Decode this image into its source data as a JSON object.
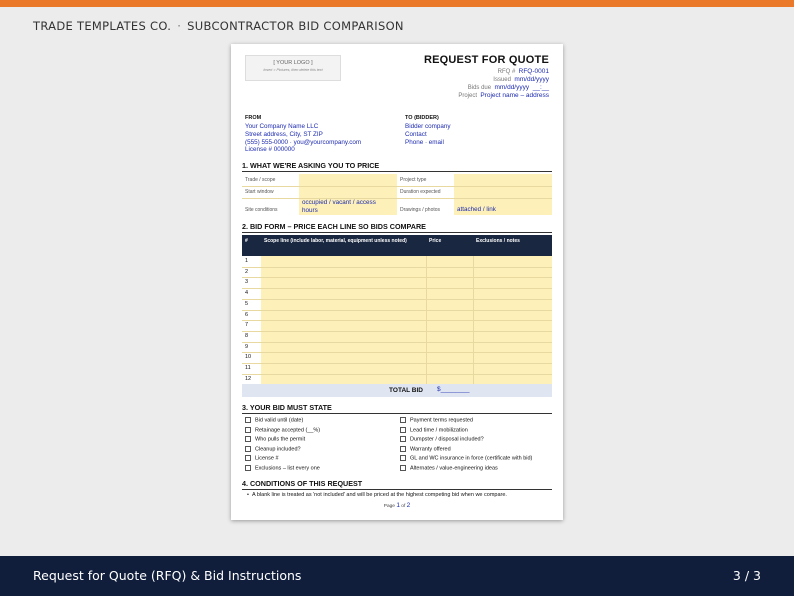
{
  "header": {
    "brand": "TRADE TEMPLATES CO.",
    "separator": "·",
    "subtitle": "SUBCONTRACTOR BID COMPARISON"
  },
  "footer": {
    "title": "Request for Quote (RFQ) & Bid Instructions",
    "page": "3 / 3"
  },
  "colors": {
    "accent": "#ea7a2a",
    "footer_bg": "#101e3c",
    "table_header": "#1a2740",
    "highlight": "#fdf0b9",
    "link_text": "#1d2bb0"
  },
  "doc": {
    "logo": {
      "label": "[ YOUR LOGO ]",
      "hint": "Insert > Pictures, then delete this text"
    },
    "title": "REQUEST FOR QUOTE",
    "meta": [
      {
        "label": "RFQ #",
        "value": "RFQ-0001"
      },
      {
        "label": "Issued",
        "value": "mm/dd/yyyy"
      },
      {
        "label": "Bids due",
        "value": "mm/dd/yyyy  __:__"
      },
      {
        "label": "Project",
        "value": "Project name – address"
      }
    ],
    "from": {
      "label": "FROM",
      "lines": [
        "Your Company Name LLC",
        "Street address, City, ST ZIP",
        "(555) 555-0000 · you@yourcompany.com",
        "License # 000000"
      ]
    },
    "to": {
      "label": "TO (BIDDER)",
      "lines": [
        "Bidder company",
        "Contact",
        "Phone · email"
      ]
    },
    "section1": {
      "title": "1. WHAT WE'RE ASKING YOU TO PRICE",
      "rows": [
        {
          "l1": "Trade / scope",
          "v1": "",
          "l2": "Project type",
          "v2": ""
        },
        {
          "l1": "Start window",
          "v1": "",
          "l2": "Duration expected",
          "v2": ""
        },
        {
          "l1": "Site conditions",
          "v1": "occupied / vacant / access hours",
          "l2": "Drawings / photos",
          "v2": "attached / link"
        }
      ]
    },
    "section2": {
      "title": "2. BID FORM – PRICE EACH LINE SO BIDS COMPARE",
      "headers": {
        "num": "#",
        "scope": "Scope line (include labor, material, equipment unless noted)",
        "price": "Price",
        "excl": "Exclusions / notes"
      },
      "rows": [
        "1",
        "2",
        "3",
        "4",
        "5",
        "6",
        "7",
        "8",
        "9",
        "10",
        "11",
        "12"
      ],
      "total_label": "TOTAL BID",
      "total_value": "$________"
    },
    "section3": {
      "title": "3. YOUR BID MUST STATE",
      "left": [
        "Bid valid until (date)",
        "Retainage accepted (__%)",
        "Who pulls the permit",
        "Cleanup included?",
        "License #",
        "Exclusions – list every one"
      ],
      "right": [
        "Payment terms requested",
        "Lead time / mobilization",
        "Dumpster / disposal included?",
        "Warranty offered",
        "GL and WC insurance in force (certificate with bid)",
        "Alternates / value-engineering ideas"
      ]
    },
    "section4": {
      "title": "4. CONDITIONS OF THIS REQUEST",
      "bullet": "A blank line is treated as 'not included' and will be priced at the highest competing bid when we compare."
    },
    "page_footer": {
      "prefix": "Page ",
      "current": "1",
      "of": " of ",
      "total": "2"
    }
  }
}
